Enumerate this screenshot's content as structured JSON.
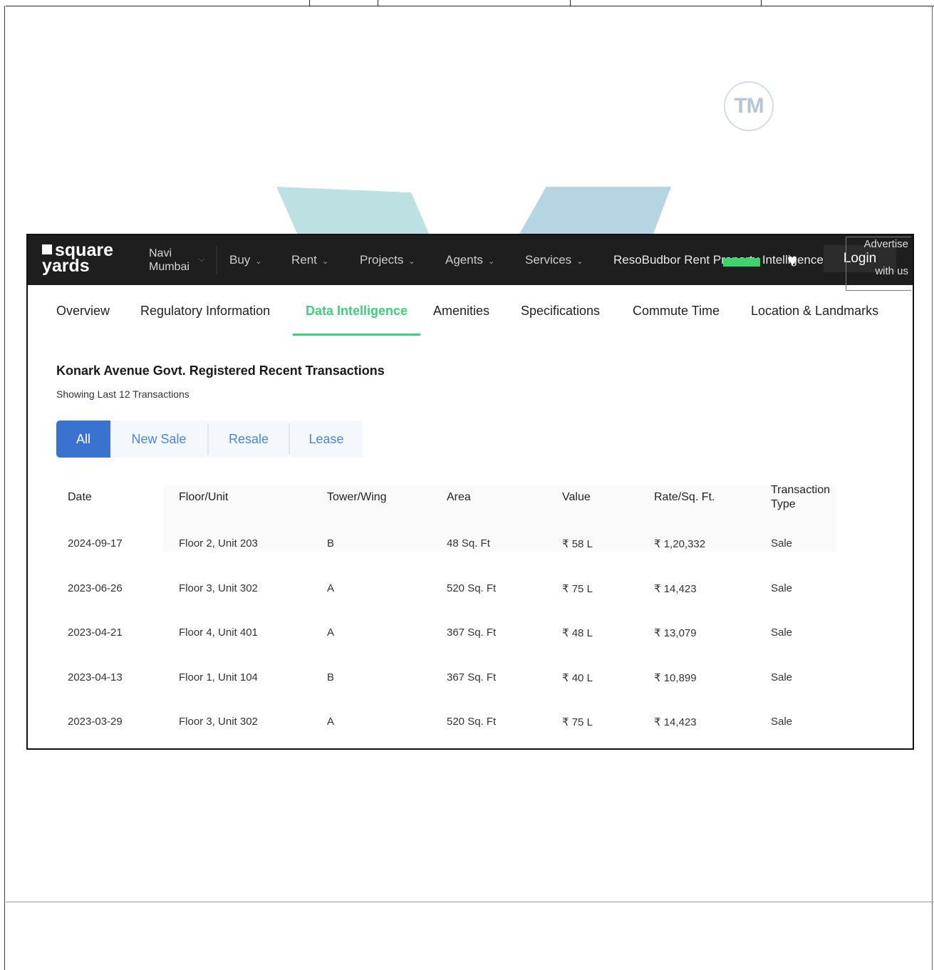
{
  "watermark": {
    "tm_text": "TM"
  },
  "navbar": {
    "logo_line1": "square",
    "logo_line2": "yards",
    "city_line1": "Navi",
    "city_line2": "Mumbai",
    "items": [
      {
        "label": "Buy"
      },
      {
        "label": "Rent"
      },
      {
        "label": "Projects"
      },
      {
        "label": "Agents"
      },
      {
        "label": "Services"
      }
    ],
    "overlap_text": "ResoBudbor Rent Property Intelligence",
    "login_label": "Login",
    "advertise_line1": "Advertise",
    "advertise_line2": "with us"
  },
  "subnav": {
    "tabs": [
      {
        "label": "Overview"
      },
      {
        "label": "Regulatory Information"
      },
      {
        "label": "Data Intelligence"
      },
      {
        "label": "Amenities"
      },
      {
        "label": "Specifications"
      },
      {
        "label": "Commute Time"
      },
      {
        "label": "Location & Landmarks"
      }
    ],
    "active_tab": "Data Intelligence",
    "accent_color": "#3fcf7c"
  },
  "transactions": {
    "title": "Konark Avenue Govt. Registered Recent Transactions",
    "subtitle": "Showing Last 12 Transactions",
    "filters": [
      {
        "label": "All"
      },
      {
        "label": "New Sale"
      },
      {
        "label": "Resale"
      },
      {
        "label": "Lease"
      }
    ],
    "active_filter": "All",
    "filter_color": "#3a72cf",
    "columns": [
      "Date",
      "Floor/Unit",
      "Tower/Wing",
      "Area",
      "Value",
      "Rate/Sq. Ft.",
      "Transaction Type"
    ],
    "rows": [
      [
        "2024-09-17",
        "Floor 2, Unit 203",
        "B",
        "48 Sq. Ft",
        "₹ 58 L",
        "₹ 1,20,332",
        "Sale"
      ],
      [
        "2023-06-26",
        "Floor 3, Unit 302",
        "A",
        "520 Sq. Ft",
        "₹ 75 L",
        "₹ 14,423",
        "Sale"
      ],
      [
        "2023-04-21",
        "Floor 4, Unit 401",
        "A",
        "367 Sq. Ft",
        "₹ 48 L",
        "₹ 13,079",
        "Sale"
      ],
      [
        "2023-04-13",
        "Floor 1, Unit 104",
        "B",
        "367 Sq. Ft",
        "₹ 40 L",
        "₹ 10,899",
        "Sale"
      ],
      [
        "2023-03-29",
        "Floor 3, Unit 302",
        "A",
        "520 Sq. Ft",
        "₹ 75 L",
        "₹ 14,423",
        "Sale"
      ]
    ]
  }
}
